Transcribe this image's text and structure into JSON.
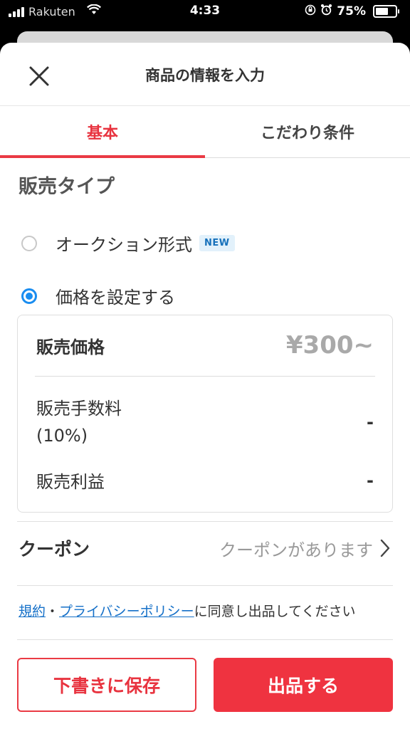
{
  "status_bar": {
    "carrier": "Rakuten",
    "time": "4:33",
    "battery": "75%",
    "battery_level": 0.75
  },
  "header": {
    "title": "商品の情報を入力",
    "close_icon": "close-icon"
  },
  "tabs": [
    {
      "label": "基本",
      "active": true
    },
    {
      "label": "こだわり条件",
      "active": false
    }
  ],
  "sale_type": {
    "title": "販売タイプ",
    "options": [
      {
        "label": "オークション形式",
        "badge": "NEW",
        "selected": false
      },
      {
        "label": "価格を設定する",
        "selected": true
      }
    ]
  },
  "price_box": {
    "price_label": "販売価格",
    "price_value": "¥300~",
    "fee_label": "販売手数料",
    "fee_rate": "(10%)",
    "fee_value": "-",
    "profit_label": "販売利益",
    "profit_value": "-"
  },
  "coupon": {
    "label": "クーポン",
    "value": "クーポンがあります"
  },
  "terms": {
    "link_terms": "規約",
    "separator": "・",
    "link_privacy": "プライバシーポリシー",
    "text": "に同意し出品してください"
  },
  "buttons": {
    "draft": "下書きに保存",
    "submit": "出品する"
  },
  "colors": {
    "accent_red": "#ea3a44",
    "radio_blue": "#1a8df0",
    "link_blue": "#1570c8"
  }
}
